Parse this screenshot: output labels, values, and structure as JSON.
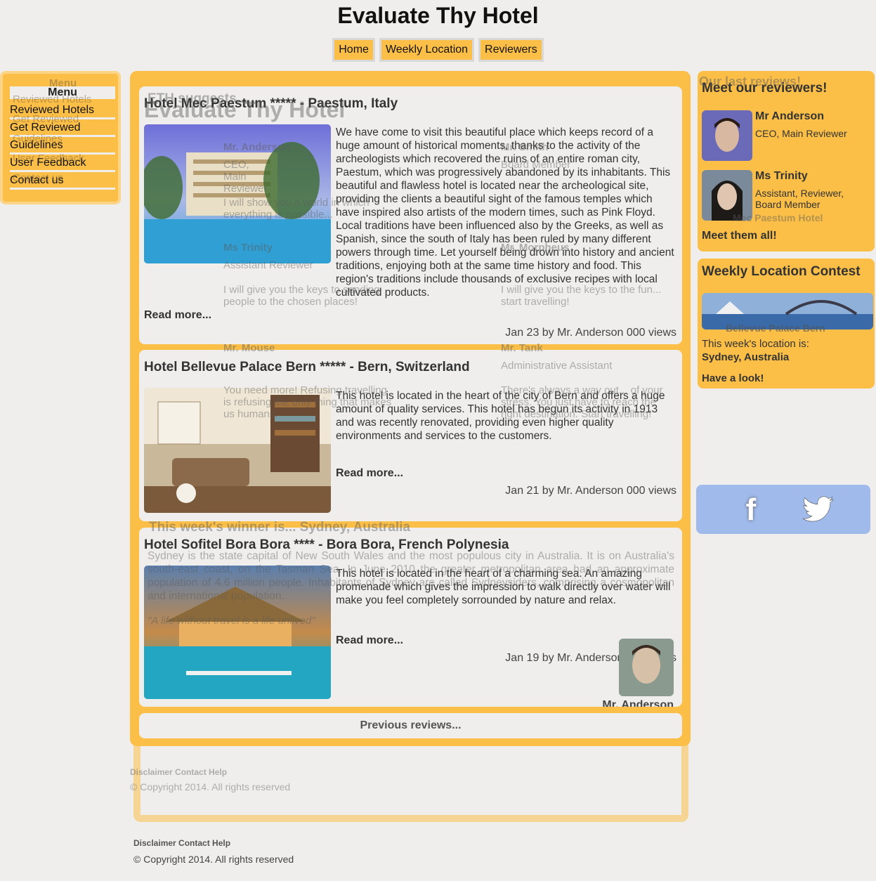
{
  "site": {
    "title": "Evaluate Thy Hotel"
  },
  "nav": [
    "Home",
    "Weekly Location",
    "Reviewers"
  ],
  "menu": {
    "title": "Menu",
    "items": [
      "Reviewed Hotels",
      "Get Reviewed",
      "Guidelines",
      "User Feedback",
      "Contact us"
    ]
  },
  "reviews": [
    {
      "title": "Hotel Mec Paestum ***** - Paestum, Italy",
      "body": "We have come to visit this beautiful place which keeps record of a huge amount of historical moments, thanks to the activity of the archeologists which recovered the ruins of an entire roman city, Paestum, which was progressively abandoned by its inhabitants. This beautiful and flawless hotel is located near the archeological site, providing the clients a beautiful sight of the famous temples which have inspired also artists of the modern times, such as Pink Floyd. Local traditions have been influenced also by the Greeks, as well as Spanish, since the south of Italy has been ruled by many different powers through time. Let yourself being drown into history and ancient traditions, enjoying both at the same time history and food. This region's traditions include thousands of exclusive recipes with local cultivated products.",
      "read_more": "Read more...",
      "meta": "Jan 23 by Mr. Anderson 000 views"
    },
    {
      "title": "Hotel Bellevue Palace Bern ***** - Bern, Switzerland",
      "body": "This hotel is located in the heart of the city of Bern and offers a huge amount of quality services. This hotel has begun its activity in 1913 and was recently renovated, providing even higher quality environments and services to the customers.",
      "read_more": "Read more...",
      "meta": "Jan 21 by Mr. Anderson 000 views"
    },
    {
      "title": "Hotel Sofitel Bora Bora **** - Bora Bora, French Polynesia",
      "body": "This hotel is located in the heart of a charming sea. An amazing promenade which gives the impression to walk directly over water will make you feel completely sorrounded by nature and relax.",
      "read_more": "Read more...",
      "meta": "Jan 19 by Mr. Anderson 000 views",
      "author": "Mr. Anderson"
    }
  ],
  "previous": "Previous reviews...",
  "reviewers": {
    "title": "Meet our reviewers!",
    "people": [
      {
        "name": "Mr Anderson",
        "role": "CEO, Main Reviewer"
      },
      {
        "name": "Ms Trinity",
        "role": "Assistant, Reviewer, Board Member"
      }
    ],
    "meet_all": "Meet them all!"
  },
  "contest": {
    "title": "Weekly Location Contest",
    "caption": "Bellevue Palace Bern",
    "line1": "This week's location is:",
    "line2": "Sydney, Australia",
    "line3": "Have a look!"
  },
  "ghosts": {
    "suggests": "ETH suggests...",
    "site_title": "Evaluate Thy Hotel",
    "last_reviews": "Our last reviews!",
    "mec_caption": "Mec Paestum Hotel",
    "anderson": "Mr. Anderson",
    "anderson_role": "CEO, Main Reviewer",
    "anderson_quote": "I will show you a world in which everything is possible...",
    "trinity": "Ms Trinity",
    "trinity_role": "Assistant Reviewer",
    "trinity_quote": "I will give you the keys to sending people to the chosen places!",
    "smith": "Mr. Smith",
    "smith_role": "Board Member",
    "morpheus": "Mr. Morpheus",
    "morpheus_quote": "I will give you the keys to the fun... start travelling!",
    "mouse": "Mr. Mouse",
    "mouse_quote": "You need more! Refusing travelling is refusing the only thing that makes us humans.",
    "tank": "Mr. Tank",
    "tank_role": "Administrative Assistant",
    "tank_quote": "There's always a way out... of your stress. You just have to reach the right destination. Start travelling!",
    "winner": "This week's winner is... Sydney, Australia",
    "winner_text": "Sydney is the state capital of New South Wales and the most populous city in Australia. It is on Australia's south-east coast, on the Tasman Sea. In June 2010 the greater metropolitan area had an approximate population of 4.6 million people. Inhabitants of Sydney are called Sydneysiders, comprising a cosmopolitan and international population.",
    "winner_quote": "\"A life without travel is a life unlived\"",
    "footer_links": "Disclaimer Contact Help",
    "footer_copy": "© Copyright 2014. All rights reserved"
  },
  "footer": {
    "links": "Disclaimer Contact Help",
    "copyright": "© Copyright 2014. All rights reserved"
  },
  "colors": {
    "accent": "#fbbf48",
    "background": "#efeeed",
    "social": "#9fbaeb"
  }
}
